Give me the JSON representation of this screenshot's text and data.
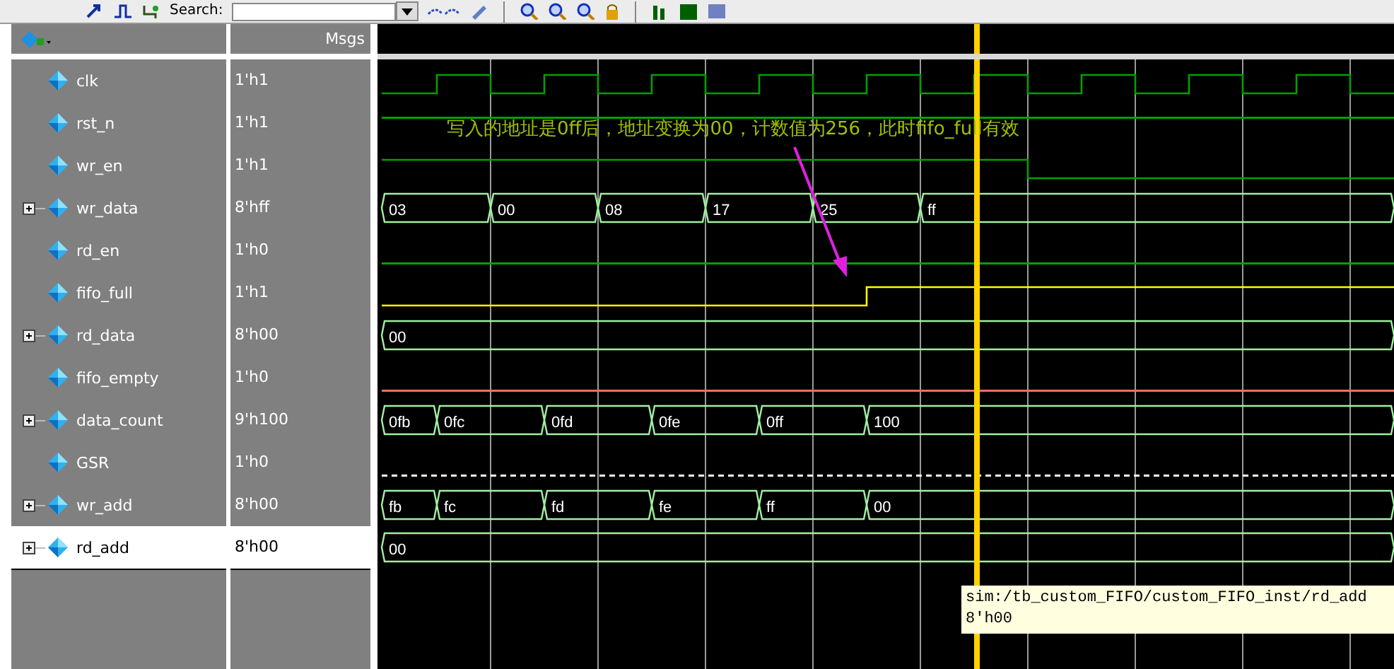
{
  "toolbar": {
    "search_label": "Search:"
  },
  "header": {
    "values_title": "Msgs"
  },
  "signals": [
    {
      "name": "clk",
      "value": "1'h1",
      "expandable": false,
      "selected": false,
      "kind": "clock",
      "color": "#00a000"
    },
    {
      "name": "rst_n",
      "value": "1'h1",
      "expandable": false,
      "selected": false,
      "kind": "high",
      "color": "#00a000"
    },
    {
      "name": "wr_en",
      "value": "1'h1",
      "expandable": false,
      "selected": false,
      "kind": "fall",
      "color": "#00a000"
    },
    {
      "name": "wr_data",
      "value": "8'hff",
      "expandable": true,
      "selected": false,
      "kind": "bus",
      "color": "#a0f0a0",
      "segments": [
        "03",
        "00",
        "08",
        "17",
        "25",
        "ff"
      ]
    },
    {
      "name": "rd_en",
      "value": "1'h0",
      "expandable": false,
      "selected": false,
      "kind": "low",
      "color": "#00a000"
    },
    {
      "name": "fifo_full",
      "value": "1'h1",
      "expandable": false,
      "selected": false,
      "kind": "rise",
      "color": "#ffff00"
    },
    {
      "name": "rd_data",
      "value": "8'h00",
      "expandable": true,
      "selected": false,
      "kind": "bus",
      "color": "#a0f0a0",
      "segments": [
        "00"
      ]
    },
    {
      "name": "fifo_empty",
      "value": "1'h0",
      "expandable": false,
      "selected": false,
      "kind": "low",
      "color": "#f07060"
    },
    {
      "name": "data_count",
      "value": "9'h100",
      "expandable": true,
      "selected": false,
      "kind": "bus",
      "color": "#a0f0a0",
      "segments": [
        "0fb",
        "0fc",
        "0fd",
        "0fe",
        "0ff",
        "100"
      ]
    },
    {
      "name": "GSR",
      "value": "1'h0",
      "expandable": false,
      "selected": false,
      "kind": "dashed",
      "color": "#ffffff"
    },
    {
      "name": "wr_add",
      "value": "8'h00",
      "expandable": true,
      "selected": false,
      "kind": "bus",
      "color": "#a0f0a0",
      "segments": [
        "fb",
        "fc",
        "fd",
        "fe",
        "ff",
        "00"
      ]
    },
    {
      "name": "rd_add",
      "value": "8'h00",
      "expandable": true,
      "selected": true,
      "kind": "bus",
      "color": "#a0f0a0",
      "segments": [
        "00"
      ]
    }
  ],
  "annotation": "写入的地址是0ff后，地址变换为00，计数值为256，此时fifo_full有效",
  "tooltip": {
    "path": "sim:/tb_custom_FIFO/custom_FIFO_inst/rd_add",
    "value": "8'h00"
  }
}
